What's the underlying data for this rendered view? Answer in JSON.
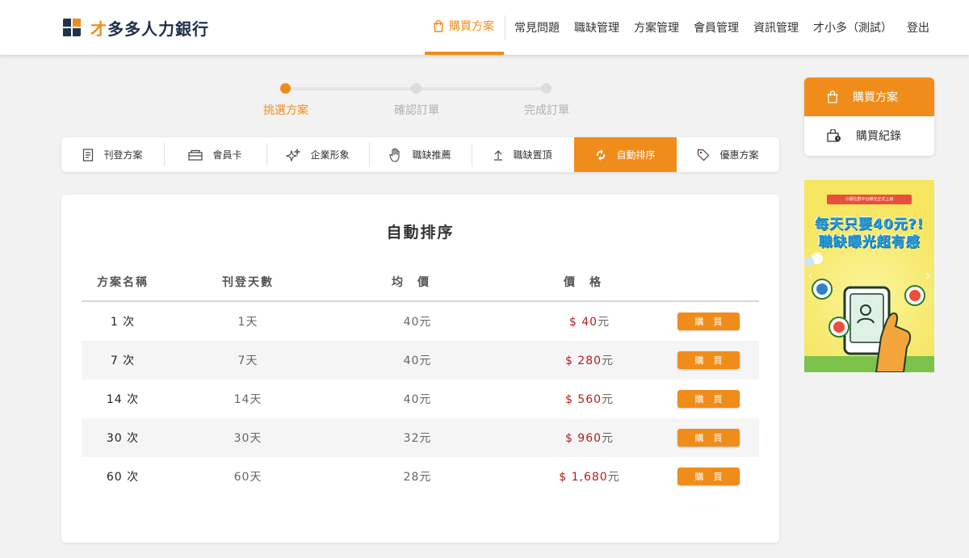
{
  "header": {
    "logo_accent": "才",
    "logo_text": "多多人力銀行",
    "nav": [
      {
        "label": "購買方案",
        "active": true
      },
      {
        "label": "常見問題"
      },
      {
        "label": "職缺管理"
      },
      {
        "label": "方案管理"
      },
      {
        "label": "會員管理"
      },
      {
        "label": "資訊管理"
      },
      {
        "label": "才小多（測試）"
      },
      {
        "label": "登出"
      }
    ]
  },
  "stepper": {
    "steps": [
      {
        "label": "挑選方案",
        "active": true
      },
      {
        "label": "確認訂單",
        "active": false
      },
      {
        "label": "完成訂單",
        "active": false
      }
    ]
  },
  "tabs": [
    {
      "label": "刊登方案",
      "icon": "document-icon"
    },
    {
      "label": "會員卡",
      "icon": "card-icon"
    },
    {
      "label": "企業形象",
      "icon": "sparkle-icon"
    },
    {
      "label": "職缺推薦",
      "icon": "hand-icon"
    },
    {
      "label": "職缺置頂",
      "icon": "arrow-up-icon"
    },
    {
      "label": "自動排序",
      "icon": "refresh-icon",
      "active": true
    },
    {
      "label": "優惠方案",
      "icon": "tag-icon"
    }
  ],
  "main": {
    "title": "自動排序",
    "columns": [
      "方案名稱",
      "刊登天數",
      "均價",
      "價格"
    ],
    "buy_label": "購買",
    "rows": [
      {
        "name": "1 次",
        "days": "1天",
        "avg": "40元",
        "price": "$ 40",
        "unit": "元"
      },
      {
        "name": "7 次",
        "days": "7天",
        "avg": "40元",
        "price": "$ 280",
        "unit": "元"
      },
      {
        "name": "14 次",
        "days": "14天",
        "avg": "40元",
        "price": "$ 560",
        "unit": "元"
      },
      {
        "name": "30 次",
        "days": "30天",
        "avg": "32元",
        "price": "$ 960",
        "unit": "元"
      },
      {
        "name": "60 次",
        "days": "60天",
        "avg": "28元",
        "price": "$ 1,680",
        "unit": "元"
      }
    ]
  },
  "side_menu": {
    "items": [
      {
        "label": "購買方案",
        "icon": "shopping-bag-icon",
        "active": true
      },
      {
        "label": "購買紀錄",
        "icon": "history-bag-icon"
      }
    ]
  },
  "banner": {
    "ribbon": "小額社群平台曝光正式上線",
    "headline_1": "每天只要40元?!",
    "headline_2": "職缺曝光超有感"
  },
  "colors": {
    "accent": "#f08c1a",
    "price": "#b12020",
    "logo_dark": "#21324a"
  }
}
